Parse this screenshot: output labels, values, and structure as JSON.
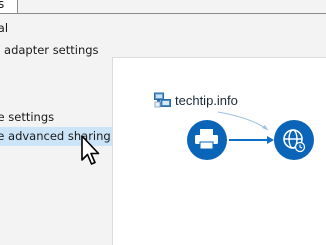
{
  "window": {
    "tab_fragment": "s"
  },
  "menu": {
    "items": [
      {
        "label": "eral"
      },
      {
        "label": "ge adapter settings"
      },
      {
        "label": "ote settings"
      },
      {
        "label": "ge advanced sharing settings"
      }
    ]
  },
  "panel": {
    "brand_text": "techtip.info"
  },
  "icons": {
    "brand": "network-computers-icon",
    "printer": "printer-icon",
    "globe": "globe-clock-icon",
    "cursor": "mouse-pointer-icon"
  },
  "colors": {
    "accent": "#0a64b8",
    "selection": "#cce4f7",
    "arrow": "#0e6dc6"
  }
}
